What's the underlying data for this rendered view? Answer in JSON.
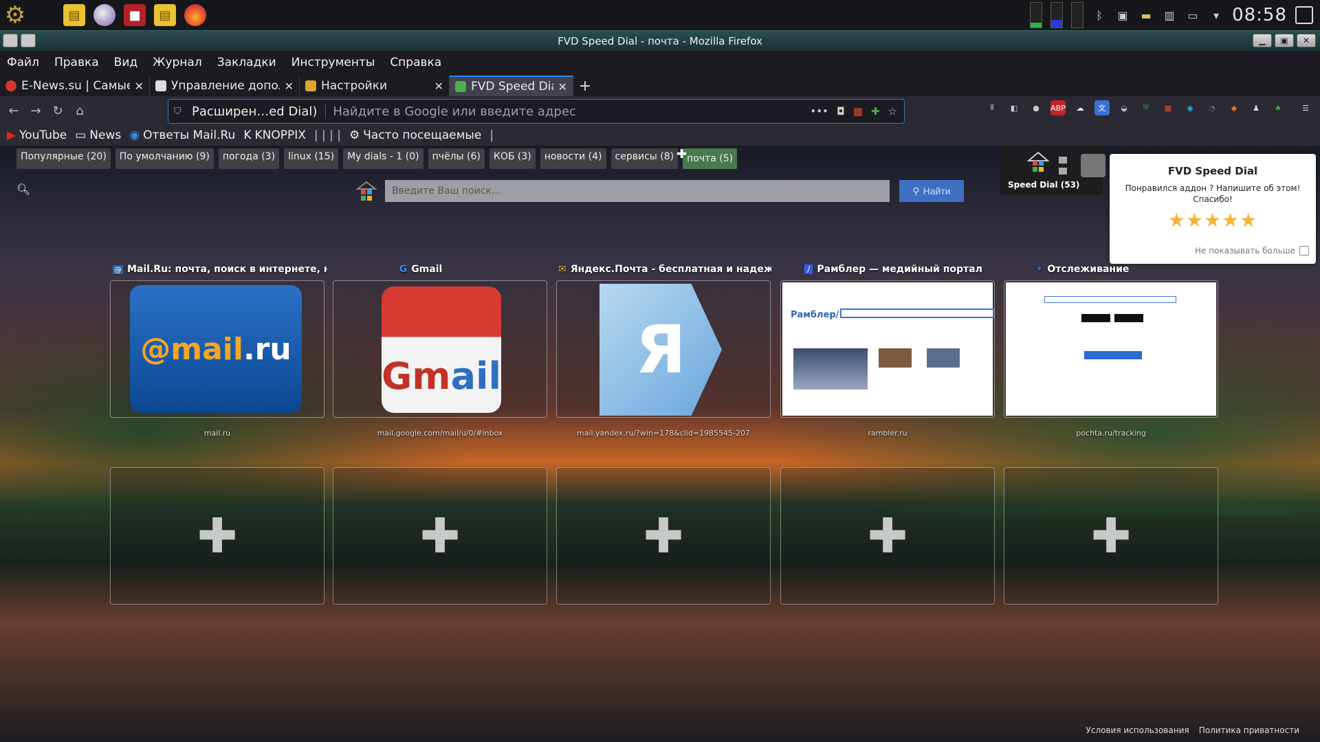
{
  "system_panel": {
    "clock": "08:58",
    "launcher_icons": [
      "gear-icon",
      "notes-icon",
      "orb-icon",
      "screen-recorder-icon",
      "notes-icon",
      "firefox-icon"
    ],
    "tray_icons": [
      "bluetooth-icon",
      "network-icon",
      "folder-icon",
      "clipboard-icon",
      "display-icon",
      "chevron-down-icon"
    ]
  },
  "window": {
    "title": "FVD Speed Dial - почта - Mozilla Firefox"
  },
  "menu": [
    "Файл",
    "Правка",
    "Вид",
    "Журнал",
    "Закладки",
    "Инструменты",
    "Справка"
  ],
  "tabs": [
    {
      "label": "E-News.su | Самые",
      "fav_color": "#d33a2c",
      "active": false
    },
    {
      "label": "Управление допол",
      "fav_color": "#dddddd",
      "active": false
    },
    {
      "label": "Настройки",
      "fav_color": "#e0a530",
      "active": false
    },
    {
      "label": "FVD Speed Dial - по",
      "fav_color": "#4caf50",
      "active": true
    }
  ],
  "urlbar": {
    "identity": "Расширен…ed Dial)",
    "placeholder": "Найдите в Google или введите адрес"
  },
  "bookmarks": [
    {
      "label": "YouTube",
      "icon": "youtube-icon"
    },
    {
      "label": "News",
      "icon": "folder-icon"
    },
    {
      "label": "Ответы Mail.Ru",
      "icon": "mailru-icon"
    },
    {
      "label": "KNOPPIX",
      "icon": "knoppix-icon"
    },
    {
      "label": "Часто посещаемые",
      "icon": "gear-icon"
    }
  ],
  "groups": [
    {
      "label": "Популярные (20)"
    },
    {
      "label": "По умолчанию (9)"
    },
    {
      "label": "погода (3)"
    },
    {
      "label": "linux (15)"
    },
    {
      "label": "My dials - 1 (0)"
    },
    {
      "label": "пчёлы (6)"
    },
    {
      "label": "КОБ (3)"
    },
    {
      "label": "новости (4)"
    },
    {
      "label": "сервисы (8)"
    },
    {
      "label": "почта (5)",
      "active": true
    }
  ],
  "speed_dial_panel": {
    "label": "Speed Dial (53)"
  },
  "popup": {
    "title": "FVD Speed Dial",
    "text1": "Понравился аддон ? Напишите об этом!",
    "text2": "Спасибо!",
    "stars": "★★★★★",
    "hide_label": "Не показывать больше"
  },
  "search": {
    "placeholder": "Введите Ваш поиск...",
    "button": "Найти"
  },
  "dials": [
    {
      "title": "Mail.Ru: почта, поиск в интернете, н...",
      "url": "mail.ru",
      "icon": "mailru-icon"
    },
    {
      "title": "Gmail",
      "url": "mail.google.com/mail/u/0/#inbox",
      "icon": "google-icon"
    },
    {
      "title": "Яндекс.Почта - бесплатная и надежн...",
      "url": "mail.yandex.ru/?win=178&clid=1985545-207",
      "icon": "yandex-mail-icon"
    },
    {
      "title": "Рамблер — медийный портал",
      "url": "rambler.ru",
      "icon": "rambler-icon"
    },
    {
      "title": "Отслеживание",
      "url": "pochta.ru/tracking",
      "icon": "pochta-icon"
    }
  ],
  "thumbs": {
    "mail_text": "@mail",
    "mail_text2": ".ru",
    "gmail_text": "Gm",
    "gmail_text2": "ail",
    "yandex_letter": "Я",
    "rambler_logo": "Рамблер/"
  },
  "footer": {
    "terms": "Условия использования",
    "privacy": "Политика приватности"
  }
}
